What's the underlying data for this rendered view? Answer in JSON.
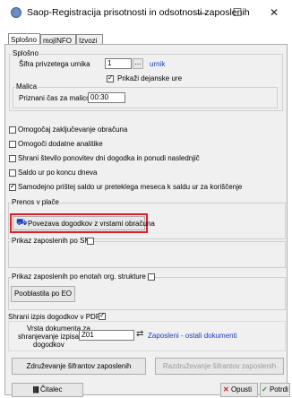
{
  "window": {
    "title": "Saop-Registracija prisotnosti in odsotnosti zaposlenih",
    "minimize": "—",
    "maximize": "☐",
    "close": "✕"
  },
  "tabs": [
    "Splošno",
    "mojINFO",
    "Izvozi"
  ],
  "splosno": {
    "legend": "Splošno",
    "sifra_label": "Šifra privzetega urnika",
    "sifra_value": "1",
    "lookup_label": "...",
    "urnik_link": "urnik",
    "prikazi_dejanske_ure": "Prikaži dejanske ure",
    "malica_legend": "Malica",
    "priznani_cas_label": "Priznani čas za malico",
    "priznani_cas_value": "00:30"
  },
  "options": [
    {
      "label": "Omogočaj zaključevanje obračuna",
      "checked": false
    },
    {
      "label": "Omogoči dodatne analitike",
      "checked": false
    },
    {
      "label": "Shrani število ponovitev dni dogodka in ponudi naslednjič",
      "checked": false
    },
    {
      "label": "Saldo ur po koncu dneva",
      "checked": false
    },
    {
      "label": "Samodejno prištej saldo ur preteklega meseca k saldu ur za koriščenje",
      "checked": true
    }
  ],
  "prenos": {
    "legend": "Prenos v plače",
    "button_label": "Povezava dogodkov z vrstami obračuna"
  },
  "prikaz_sm": {
    "legend": "Prikaz zaposlenih po SM"
  },
  "prikaz_eo": {
    "legend": "Prikaz zaposlenih po enotah org. strukture",
    "button_label": "Pooblastila po EO"
  },
  "pdf": {
    "checkbox_label": "Shrani izpis dogodkov v PDF",
    "vrsta_label_1": "Vrsta dokumenta za",
    "vrsta_label_2": "shranjevanje izpisa",
    "vrsta_label_3": "dogodkov",
    "vrsta_value": "Z01",
    "vrsta_link": "Zaposleni - ostali dokumenti"
  },
  "sifranti": {
    "zdruzevanje": "Združevanje šifrantov zaposlenih",
    "razzdruzevanje": "Razdruževanje šifrantov zaposlenih"
  },
  "footer": {
    "citalec": "Čitalec",
    "opusti": "Opusti",
    "potrdi": "Potrdi"
  },
  "colors": {
    "highlight": "#e51c23",
    "link": "#1a3fbf",
    "panel": "#f0f0f0"
  }
}
